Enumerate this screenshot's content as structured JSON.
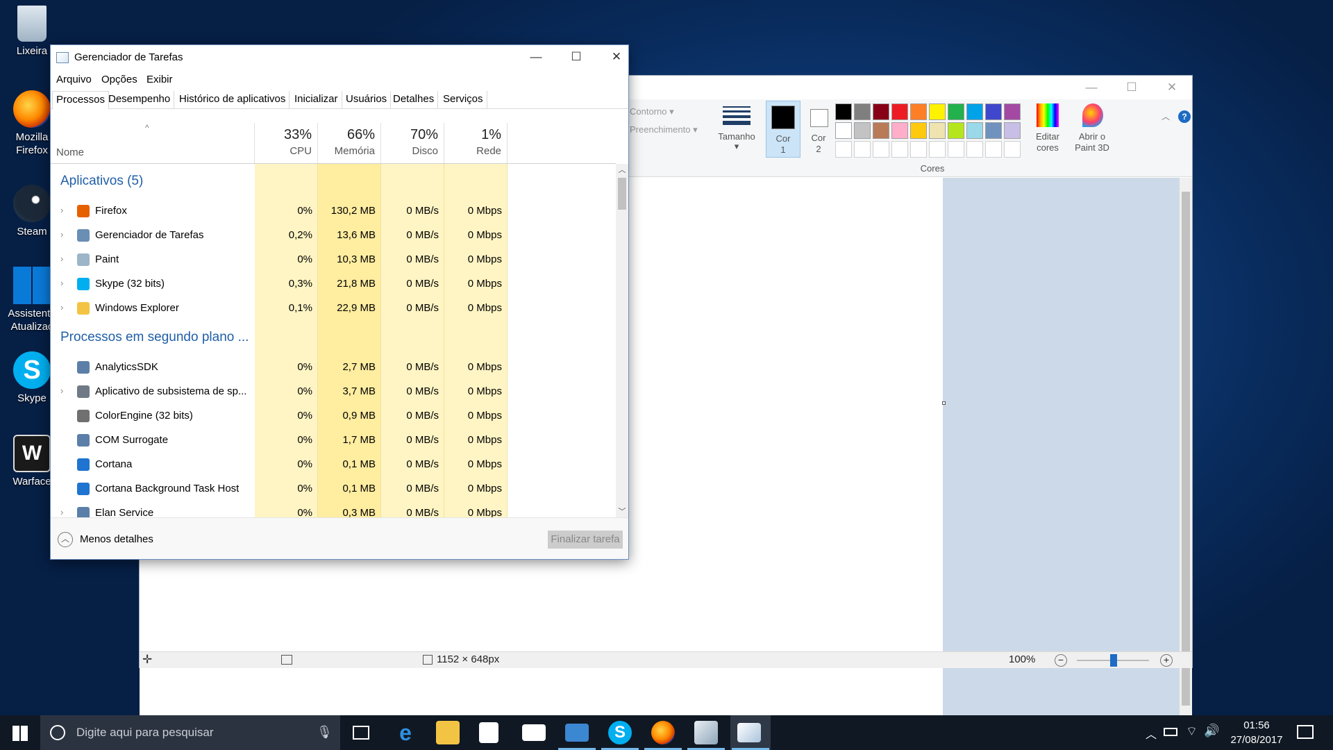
{
  "desktop_icons": [
    {
      "label": "Lixeira",
      "icon": "recycle-bin-icon"
    },
    {
      "label": "Mozilla Firefox",
      "line1": "Mozilla",
      "line2": "Firefox",
      "icon": "firefox-icon"
    },
    {
      "label": "Steam",
      "icon": "steam-icon"
    },
    {
      "label": "Assistente Atualizaç",
      "line1": "Assistente",
      "line2": "Atualizaç",
      "icon": "windows-icon"
    },
    {
      "label": "Skype",
      "icon": "skype-icon"
    },
    {
      "label": "Warface",
      "icon": "warface-icon"
    }
  ],
  "paint": {
    "ribbon": {
      "contorno": "Contorno",
      "preenchimento": "Preenchimento",
      "tamanho": "Tamanho",
      "cor1": "Cor",
      "cor1_n": "1",
      "cor2": "Cor",
      "cor2_n": "2",
      "editar": "Editar",
      "editar2": "cores",
      "abrir": "Abrir o",
      "abrir2": "Paint 3D",
      "cores_group": "Cores"
    },
    "palette_row1": [
      "#000000",
      "#7f7f7f",
      "#880015",
      "#ed1c24",
      "#ff7f27",
      "#fff200",
      "#22b14c",
      "#00a2e8",
      "#3f48cc",
      "#a349a4"
    ],
    "palette_row2": [
      "#ffffff",
      "#c3c3c3",
      "#b97a57",
      "#ffaec9",
      "#ffc90e",
      "#efe4b0",
      "#b5e61d",
      "#99d9ea",
      "#7092be",
      "#c8bfe7"
    ],
    "status": {
      "dimensions": "1152 × 648px",
      "zoom": "100%"
    }
  },
  "tm": {
    "title": "Gerenciador de Tarefas",
    "menu": [
      "Arquivo",
      "Opções",
      "Exibir"
    ],
    "tabs": [
      "Processos",
      "Desempenho",
      "Histórico de aplicativos",
      "Inicializar",
      "Usuários",
      "Detalhes",
      "Serviços"
    ],
    "columns": {
      "name": "Nome",
      "cpu": {
        "pct": "33%",
        "label": "CPU"
      },
      "mem": {
        "pct": "66%",
        "label": "Memória"
      },
      "disk": {
        "pct": "70%",
        "label": "Disco"
      },
      "net": {
        "pct": "1%",
        "label": "Rede"
      }
    },
    "group_apps": "Aplicativos (5)",
    "apps": [
      {
        "name": "Firefox",
        "cpu": "0%",
        "mem": "130,2 MB",
        "disk": "0 MB/s",
        "net": "0 Mbps",
        "icon": "firefox-icon",
        "color": "#e66000"
      },
      {
        "name": "Gerenciador de Tarefas",
        "cpu": "0,2%",
        "mem": "13,6 MB",
        "disk": "0 MB/s",
        "net": "0 Mbps",
        "icon": "task-manager-icon",
        "color": "#6a8fb5"
      },
      {
        "name": "Paint",
        "cpu": "0%",
        "mem": "10,3 MB",
        "disk": "0 MB/s",
        "net": "0 Mbps",
        "icon": "paint-icon",
        "color": "#9db5c9"
      },
      {
        "name": "Skype (32 bits)",
        "cpu": "0,3%",
        "mem": "21,8 MB",
        "disk": "0 MB/s",
        "net": "0 Mbps",
        "icon": "skype-icon",
        "color": "#00aff0"
      },
      {
        "name": "Windows Explorer",
        "cpu": "0,1%",
        "mem": "22,9 MB",
        "disk": "0 MB/s",
        "net": "0 Mbps",
        "icon": "folder-icon",
        "color": "#f3c443"
      }
    ],
    "group_bg": "Processos em segundo plano ...",
    "background": [
      {
        "name": "AnalyticsSDK",
        "cpu": "0%",
        "mem": "2,7 MB",
        "disk": "0 MB/s",
        "net": "0 Mbps",
        "icon": "service-icon",
        "color": "#5b7fa8",
        "expand": false
      },
      {
        "name": "Aplicativo de subsistema de sp...",
        "cpu": "0%",
        "mem": "3,7 MB",
        "disk": "0 MB/s",
        "net": "0 Mbps",
        "icon": "printer-icon",
        "color": "#6f7a86",
        "expand": true
      },
      {
        "name": "ColorEngine (32 bits)",
        "cpu": "0%",
        "mem": "0,9 MB",
        "disk": "0 MB/s",
        "net": "0 Mbps",
        "icon": "gear-icon",
        "color": "#707070",
        "expand": false
      },
      {
        "name": "COM Surrogate",
        "cpu": "0%",
        "mem": "1,7 MB",
        "disk": "0 MB/s",
        "net": "0 Mbps",
        "icon": "service-icon",
        "color": "#5b7fa8",
        "expand": false
      },
      {
        "name": "Cortana",
        "cpu": "0%",
        "mem": "0,1 MB",
        "disk": "0 MB/s",
        "net": "0 Mbps",
        "icon": "cortana-icon",
        "color": "#1e74d0",
        "expand": false
      },
      {
        "name": "Cortana Background Task Host",
        "cpu": "0%",
        "mem": "0,1 MB",
        "disk": "0 MB/s",
        "net": "0 Mbps",
        "icon": "cortana-icon",
        "color": "#1e74d0",
        "expand": false
      },
      {
        "name": "Elan Service",
        "cpu": "0%",
        "mem": "0,3 MB",
        "disk": "0 MB/s",
        "net": "0 Mbps",
        "icon": "service-icon",
        "color": "#5b7fa8",
        "expand": true
      }
    ],
    "less_details": "Menos detalhes",
    "end_task": "Finalizar tarefa"
  },
  "taskbar": {
    "search_placeholder": "Digite aqui para pesquisar",
    "time": "01:56",
    "date": "27/08/2017"
  }
}
